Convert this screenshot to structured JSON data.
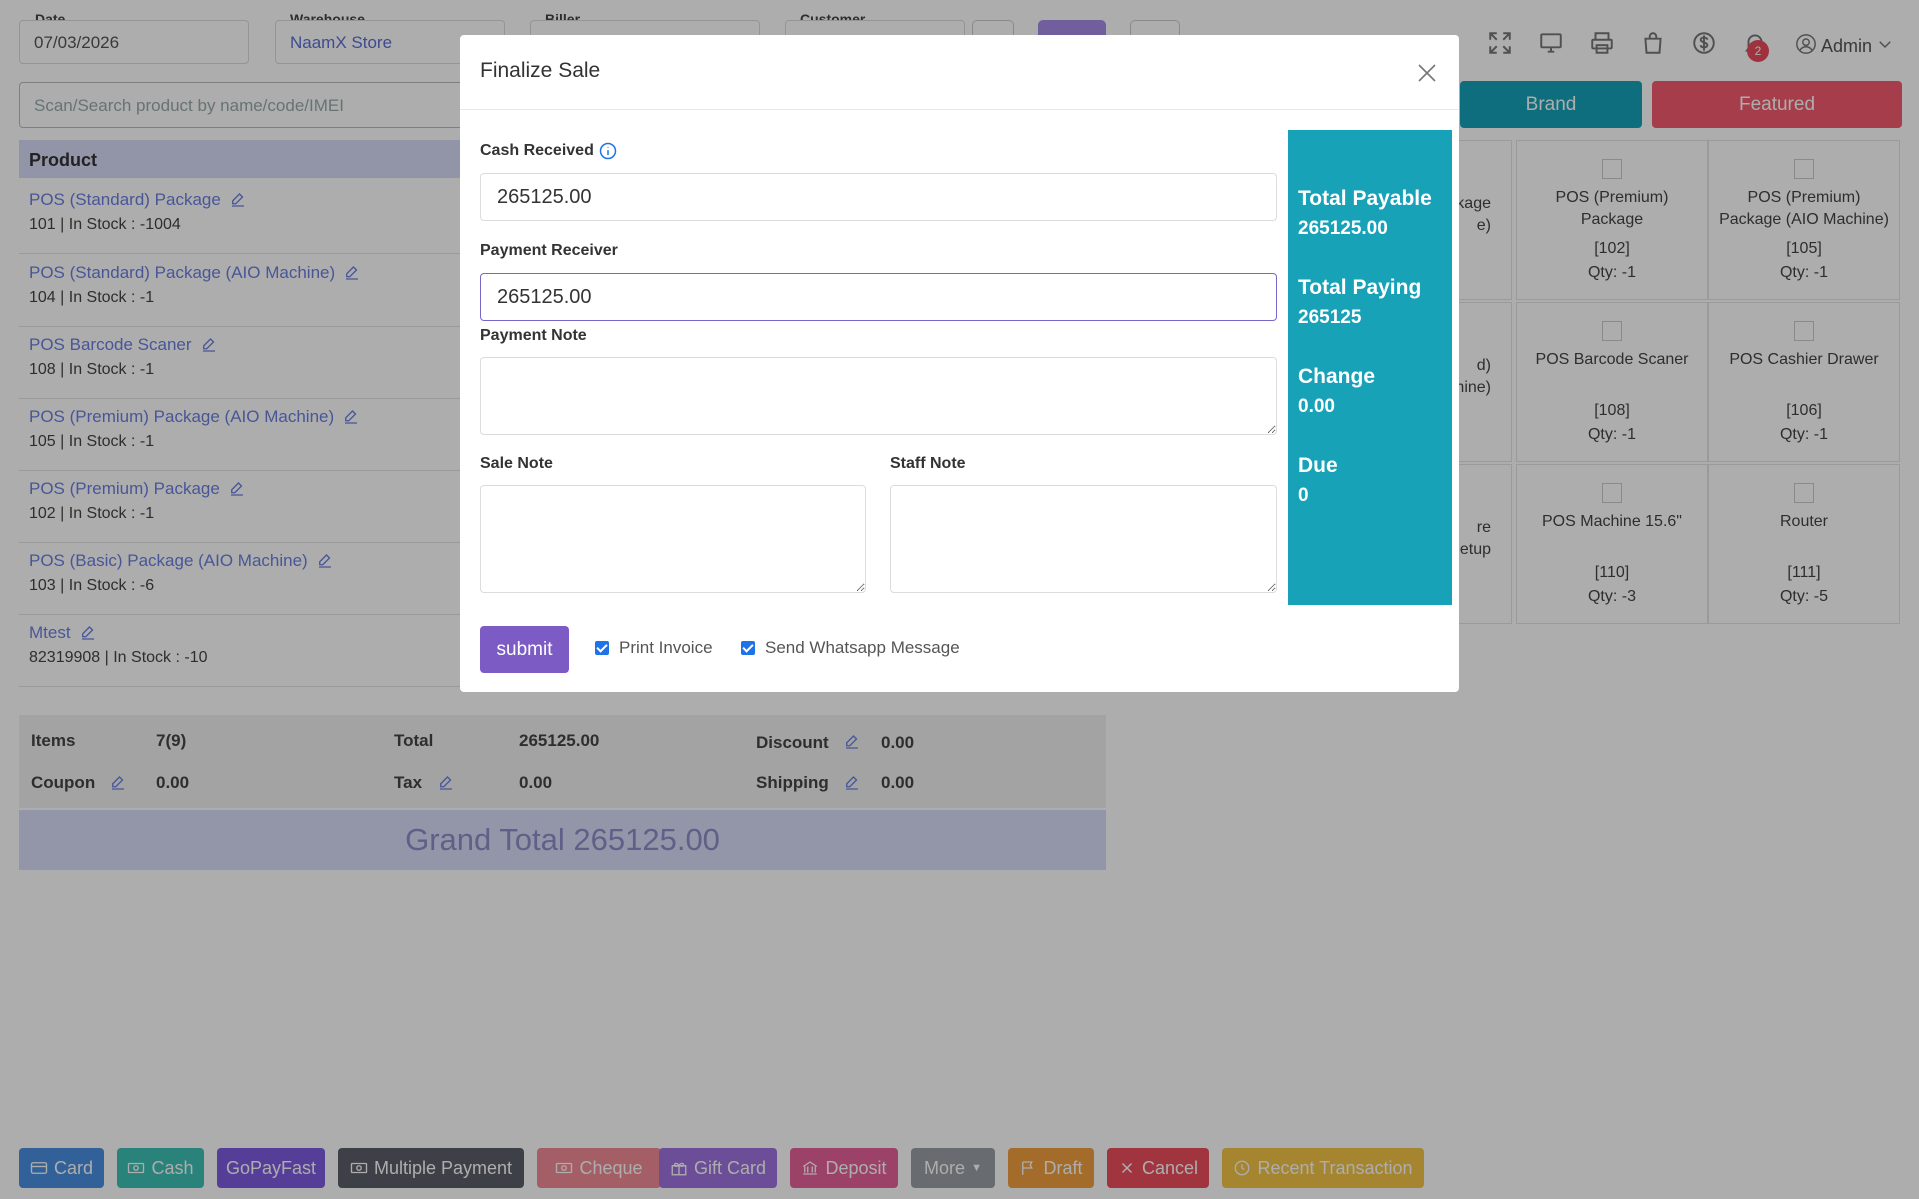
{
  "header": {
    "date_label": "Date",
    "date_value": "07/03/2026",
    "warehouse_label": "Warehouse",
    "warehouse_value": "NaamX Store",
    "biller_label": "Biller",
    "customer_label": "Customer",
    "notification_count": "2",
    "user_label": "Admin"
  },
  "search": {
    "placeholder": "Scan/Search product by name/code/IMEI"
  },
  "categories": {
    "brand_label": "Brand",
    "featured_label": "Featured"
  },
  "table": {
    "product_header": "Product",
    "rows": [
      {
        "name": "POS (Standard) Package",
        "info": "101 | In Stock : -1004"
      },
      {
        "name": "POS (Standard) Package (AIO Machine)",
        "info": "104 | In Stock : -1"
      },
      {
        "name": "POS Barcode Scaner",
        "info": "108 | In Stock : -1"
      },
      {
        "name": "POS (Premium) Package (AIO Machine)",
        "info": "105 | In Stock : -1"
      },
      {
        "name": "POS (Premium) Package",
        "info": "102 | In Stock : -1"
      },
      {
        "name": "POS (Basic) Package (AIO Machine)",
        "info": "103 | In Stock : -6"
      },
      {
        "name": "Mtest",
        "info": "82319908 | In Stock : -10"
      }
    ]
  },
  "totals": {
    "items_label": "Items",
    "items_value": "7(9)",
    "total_label": "Total",
    "total_value": "265125.00",
    "discount_label": "Discount",
    "discount_value": "0.00",
    "coupon_label": "Coupon",
    "coupon_value": "0.00",
    "tax_label": "Tax",
    "tax_value": "0.00",
    "shipping_label": "Shipping",
    "shipping_value": "0.00",
    "grand_total": "Grand Total 265125.00"
  },
  "grid": {
    "partial": [
      {
        "name_a": "kage",
        "name_b": "e)"
      },
      {
        "name_a": "d)",
        "name_b": "chine)"
      },
      {
        "name_a": "re",
        "name_b": "etup"
      }
    ],
    "items": [
      {
        "name": "POS (Premium) Package",
        "code": "[102]",
        "qty": "Qty: -1"
      },
      {
        "name": "POS (Premium) Package (AIO Machine)",
        "code": "[105]",
        "qty": "Qty: -1"
      },
      {
        "name": "POS Barcode Scaner",
        "code": "[108]",
        "qty": "Qty: -1"
      },
      {
        "name": "POS Cashier Drawer",
        "code": "[106]",
        "qty": "Qty: -1"
      },
      {
        "name": "POS Machine 15.6\"",
        "code": "[110]",
        "qty": "Qty: -3"
      },
      {
        "name": "Router",
        "code": "[111]",
        "qty": "Qty: -5"
      }
    ]
  },
  "bottom_bar": {
    "card": "Card",
    "cash": "Cash",
    "gopayfast": "GoPayFast",
    "multiple": "Multiple Payment",
    "cheque": "Cheque",
    "giftcard": "Gift Card",
    "deposit": "Deposit",
    "more": "More",
    "draft": "Draft",
    "cancel": "Cancel",
    "recent": "Recent Transaction"
  },
  "modal": {
    "title": "Finalize Sale",
    "cash_received_label": "Cash Received",
    "cash_received_value": "265125.00",
    "payment_receiver_label": "Payment Receiver",
    "payment_receiver_value": "265125.00",
    "payment_note_label": "Payment Note",
    "sale_note_label": "Sale Note",
    "staff_note_label": "Staff Note",
    "summary": {
      "total_payable_label": "Total Payable",
      "total_payable_value": "265125.00",
      "total_paying_label": "Total Paying",
      "total_paying_value": "265125",
      "change_label": "Change",
      "change_value": "0.00",
      "due_label": "Due",
      "due_value": "0"
    },
    "submit_label": "submit",
    "print_invoice_label": "Print Invoice",
    "print_invoice_checked": true,
    "whatsapp_label": "Send Whatsapp Message",
    "whatsapp_checked": true
  },
  "colors": {
    "primary": "#7c5cc4",
    "summary": "#17a2b8",
    "brand_button": "#17a2b8",
    "featured_button": "#f55a6e",
    "link": "#5a6fd6"
  }
}
